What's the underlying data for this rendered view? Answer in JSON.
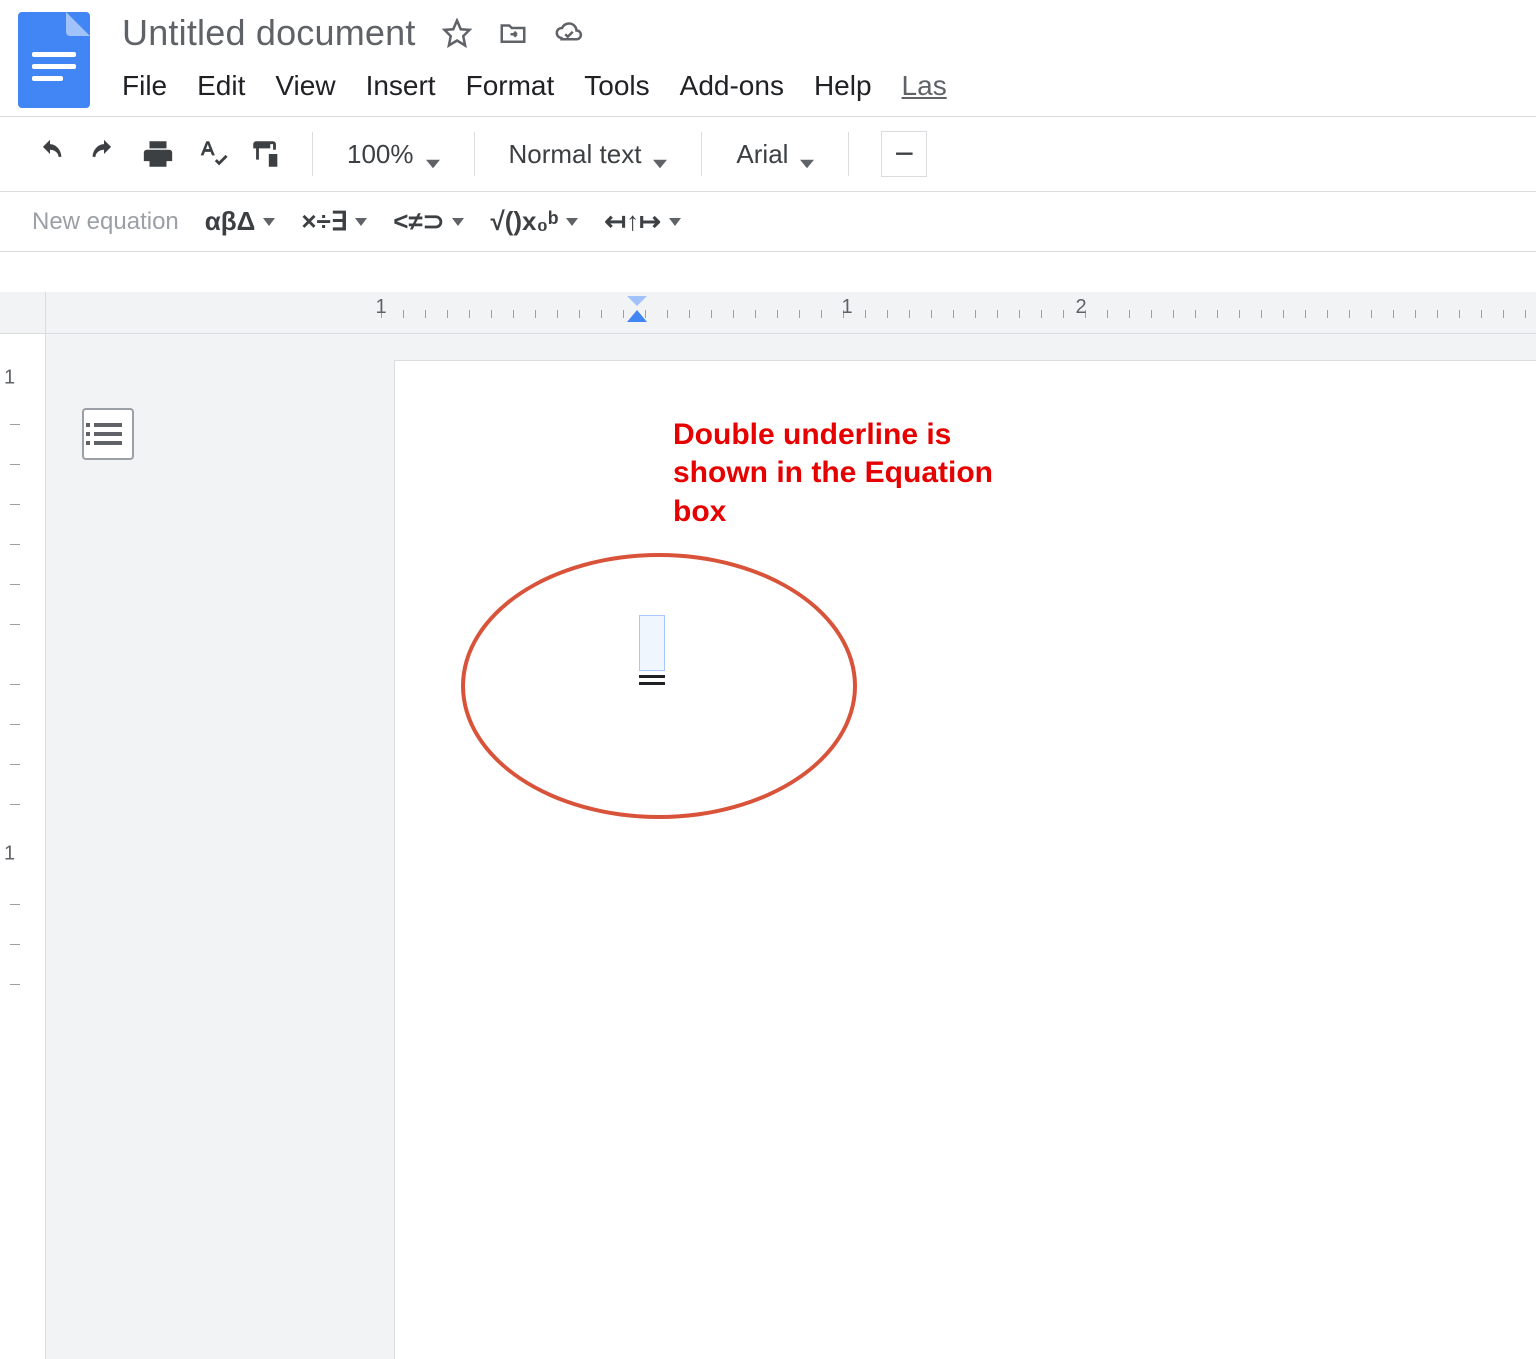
{
  "header": {
    "title": "Untitled document",
    "icons": {
      "star": "star-icon",
      "move": "folder-move-icon",
      "cloud": "cloud-saved-icon"
    }
  },
  "menubar": {
    "items": [
      "File",
      "Edit",
      "View",
      "Insert",
      "Format",
      "Tools",
      "Add-ons",
      "Help"
    ],
    "last_edit": "Las"
  },
  "toolbar": {
    "zoom": "100%",
    "style": "Normal text",
    "font": "Arial"
  },
  "equation_toolbar": {
    "new_label": "New equation",
    "groups": {
      "greek": "αβΔ",
      "operators": "×÷∃",
      "relations": "<≠⊃",
      "math": "√()x₀ᵇ",
      "arrows": "↤↑↦"
    }
  },
  "ruler": {
    "labels": [
      "1",
      "1",
      "2"
    ]
  },
  "v_ruler": {
    "label": "1"
  },
  "annotation": {
    "text": "Double underline is shown in the Equation box"
  }
}
